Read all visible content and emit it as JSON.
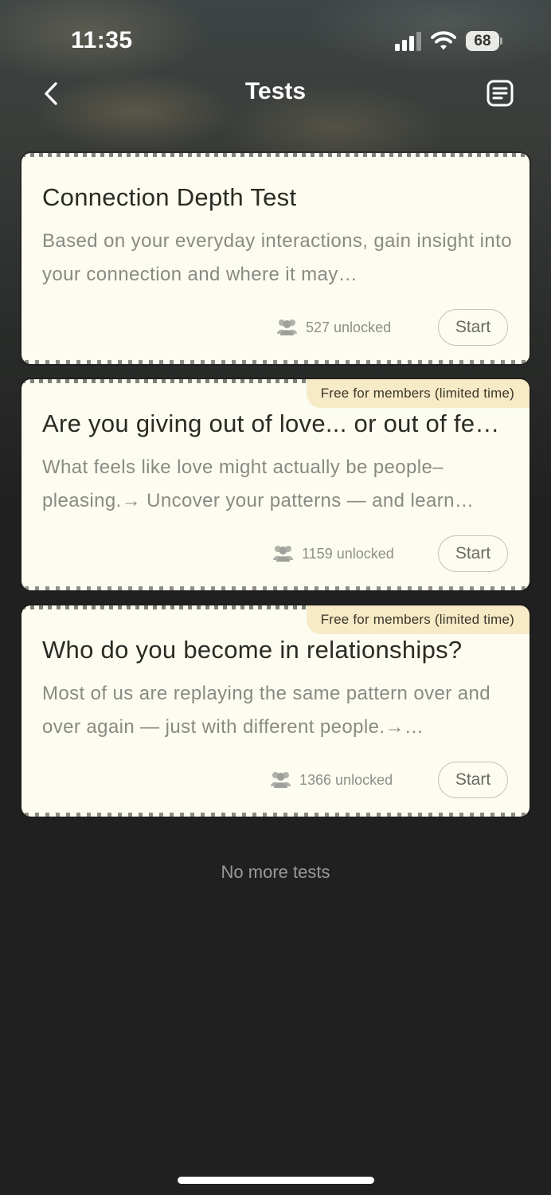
{
  "status_bar": {
    "time": "11:35",
    "battery": "68",
    "icons": [
      "cellular-signal-icon",
      "wifi-icon",
      "battery-icon"
    ]
  },
  "nav": {
    "title": "Tests",
    "back_icon": "chevron-left-icon",
    "list_icon": "list-document-icon"
  },
  "colors": {
    "card_bg": "#fcfcf1",
    "badge_bg": "#f6ebc6",
    "page_bg": "#202020",
    "muted_text": "#8a8a84"
  },
  "cards": [
    {
      "title": "Connection Depth Test",
      "description": "Based on your everyday interactions, gain insight into your connection and where it may…",
      "badge": "",
      "unlocked": "527 unlocked",
      "start_label": "Start"
    },
    {
      "title": "Are you giving out of love... or out of fear?",
      "description": "What feels like love might actually be people–pleasing.→ Uncover your patterns — and learn…",
      "badge": "Free for members (limited time)",
      "unlocked": "1159 unlocked",
      "start_label": "Start"
    },
    {
      "title": "Who do you become in relationships?",
      "description": "Most of us are replaying the same pattern over and over again — just with different people.→…",
      "badge": "Free for members (limited time)",
      "unlocked": "1366 unlocked",
      "start_label": "Start"
    }
  ],
  "footer": {
    "no_more": "No more tests"
  }
}
